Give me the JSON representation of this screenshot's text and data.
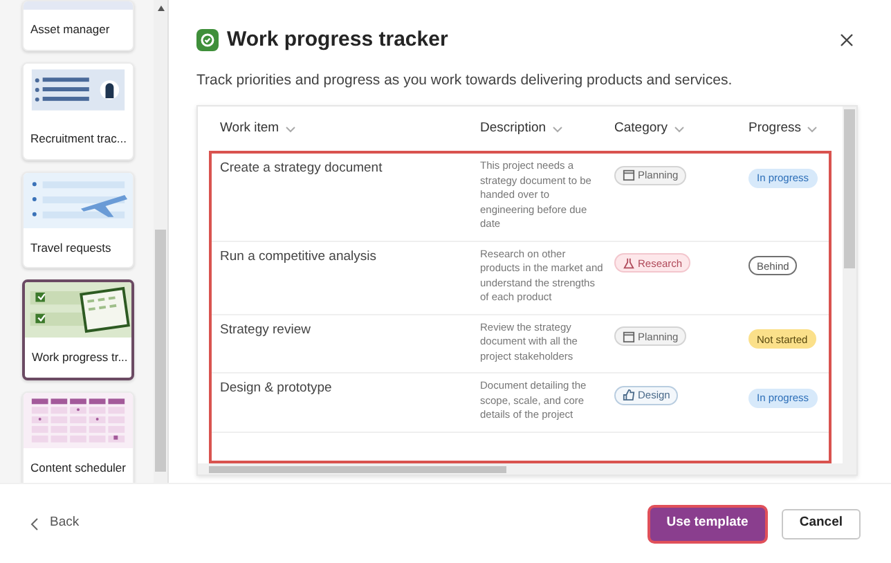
{
  "templates": [
    {
      "name": "Asset manager",
      "kind": "asset",
      "selected": false
    },
    {
      "name": "Recruitment trac...",
      "kind": "recruit",
      "selected": false
    },
    {
      "name": "Travel requests",
      "kind": "travel",
      "selected": false
    },
    {
      "name": "Work progress tr...",
      "kind": "work",
      "selected": true
    },
    {
      "name": "Content scheduler",
      "kind": "content",
      "selected": false
    }
  ],
  "dialog": {
    "title": "Work progress tracker",
    "subtitle": "Track priorities and progress as you work towards delivering products and services."
  },
  "table": {
    "columns": [
      "Work item",
      "Description",
      "Category",
      "Progress"
    ],
    "rows": [
      {
        "item": "Create a strategy document",
        "description": "This project needs a strategy document to be handed over to engineering before due date",
        "category": {
          "label": "Planning",
          "kind": "planning"
        },
        "progress": {
          "label": "In progress",
          "kind": "in_progress"
        }
      },
      {
        "item": "Run a competitive analysis",
        "description": "Research on other products in the market and understand the strengths of each product",
        "category": {
          "label": "Research",
          "kind": "research"
        },
        "progress": {
          "label": "Behind",
          "kind": "behind"
        }
      },
      {
        "item": "Strategy review",
        "description": "Review the strategy document with all the project stakeholders",
        "category": {
          "label": "Planning",
          "kind": "planning"
        },
        "progress": {
          "label": "Not started",
          "kind": "not_started"
        }
      },
      {
        "item": "Design & prototype",
        "description": "Document detailing the scope, scale, and core details of the project",
        "category": {
          "label": "Design",
          "kind": "design"
        },
        "progress": {
          "label": "In progress",
          "kind": "in_progress"
        }
      }
    ]
  },
  "footer": {
    "back": "Back",
    "primary": "Use template",
    "cancel": "Cancel"
  }
}
